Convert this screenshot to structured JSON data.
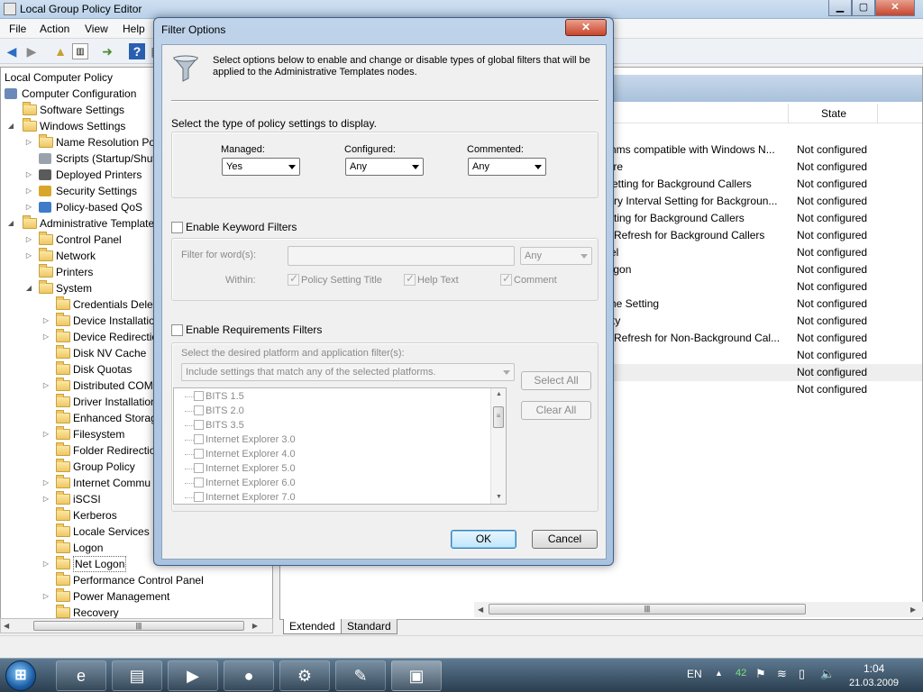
{
  "window": {
    "title": "Local Group Policy Editor",
    "controls": {
      "minimize": "▁",
      "maximize": "▢",
      "close": "✕"
    }
  },
  "menu": [
    "File",
    "Action",
    "View",
    "Help"
  ],
  "toolbar_icons": [
    "back-arrow-icon",
    "forward-arrow-icon",
    "up-folder-icon",
    "show-hide-tree-icon",
    "export-list-icon",
    "help-icon",
    "properties-icon"
  ],
  "tree": {
    "items": [
      {
        "label": "Local Computer Policy",
        "level": 0,
        "icon": "none",
        "expander": ""
      },
      {
        "label": "Computer Configuration",
        "level": 0,
        "icon": "computer",
        "expander": ""
      },
      {
        "label": "Software Settings",
        "level": 1,
        "icon": "folder",
        "expander": ""
      },
      {
        "label": "Windows Settings",
        "level": 1,
        "icon": "folder",
        "expander": "◢"
      },
      {
        "label": "Name Resolution Po",
        "level": 2,
        "icon": "folder",
        "expander": "▷"
      },
      {
        "label": "Scripts (Startup/Shut",
        "level": 2,
        "icon": "scripts",
        "expander": ""
      },
      {
        "label": "Deployed Printers",
        "level": 2,
        "icon": "printer",
        "expander": "▷"
      },
      {
        "label": "Security Settings",
        "level": 2,
        "icon": "security",
        "expander": "▷"
      },
      {
        "label": "Policy-based QoS",
        "level": 2,
        "icon": "chart",
        "expander": "▷"
      },
      {
        "label": "Administrative Templates",
        "level": 1,
        "icon": "folder",
        "expander": "◢"
      },
      {
        "label": "Control Panel",
        "level": 2,
        "icon": "folder",
        "expander": "▷"
      },
      {
        "label": "Network",
        "level": 2,
        "icon": "folder",
        "expander": "▷"
      },
      {
        "label": "Printers",
        "level": 2,
        "icon": "folder",
        "expander": ""
      },
      {
        "label": "System",
        "level": 2,
        "icon": "folder",
        "expander": "◢"
      },
      {
        "label": "Credentials Deleg",
        "level": 3,
        "icon": "folder",
        "expander": ""
      },
      {
        "label": "Device Installatio",
        "level": 3,
        "icon": "folder",
        "expander": "▷"
      },
      {
        "label": "Device Redirectio",
        "level": 3,
        "icon": "folder",
        "expander": "▷"
      },
      {
        "label": "Disk NV Cache",
        "level": 3,
        "icon": "folder",
        "expander": ""
      },
      {
        "label": "Disk Quotas",
        "level": 3,
        "icon": "folder",
        "expander": ""
      },
      {
        "label": "Distributed COM",
        "level": 3,
        "icon": "folder",
        "expander": "▷"
      },
      {
        "label": "Driver Installation",
        "level": 3,
        "icon": "folder",
        "expander": ""
      },
      {
        "label": "Enhanced Storag",
        "level": 3,
        "icon": "folder",
        "expander": ""
      },
      {
        "label": "Filesystem",
        "level": 3,
        "icon": "folder",
        "expander": "▷"
      },
      {
        "label": "Folder Redirectio",
        "level": 3,
        "icon": "folder",
        "expander": ""
      },
      {
        "label": "Group Policy",
        "level": 3,
        "icon": "folder",
        "expander": ""
      },
      {
        "label": "Internet Commu",
        "level": 3,
        "icon": "folder",
        "expander": "▷"
      },
      {
        "label": "iSCSI",
        "level": 3,
        "icon": "folder",
        "expander": "▷"
      },
      {
        "label": "Kerberos",
        "level": 3,
        "icon": "folder",
        "expander": ""
      },
      {
        "label": "Locale Services",
        "level": 3,
        "icon": "folder",
        "expander": ""
      },
      {
        "label": "Logon",
        "level": 3,
        "icon": "folder",
        "expander": ""
      },
      {
        "label": "Net Logon",
        "level": 3,
        "icon": "folder",
        "expander": "▷",
        "selected": true
      },
      {
        "label": "Performance Control Panel",
        "level": 3,
        "icon": "folder",
        "expander": ""
      },
      {
        "label": "Power Management",
        "level": 3,
        "icon": "folder",
        "expander": "▷"
      },
      {
        "label": "Recovery",
        "level": 3,
        "icon": "folder",
        "expander": ""
      }
    ]
  },
  "right_panel": {
    "state_header": "State",
    "rows": [
      {
        "setting": "ithms compatible with Windows N...",
        "state": "Not configured"
      },
      {
        "setting": "lure",
        "state": "Not configured"
      },
      {
        "setting": "Setting for Background Callers",
        "state": "Not configured"
      },
      {
        "setting": "etry Interval Setting for Backgroun...",
        "state": "Not configured"
      },
      {
        "setting": "etting for Background Callers",
        "state": "Not configured"
      },
      {
        "setting": "e Refresh for Background Callers",
        "state": "Not configured"
      },
      {
        "setting": "vel",
        "state": "Not configured"
      },
      {
        "setting": "logon",
        "state": "Not configured"
      },
      {
        "setting": "",
        "state": "Not configured"
      },
      {
        "setting": "che Setting",
        "state": "Not configured"
      },
      {
        "setting": "ility",
        "state": "Not configured"
      },
      {
        "setting": "e Refresh for Non-Background Cal...",
        "state": "Not configured"
      },
      {
        "setting": "",
        "state": "Not configured"
      },
      {
        "setting": "",
        "state": "Not configured",
        "selected": true
      },
      {
        "setting": "",
        "state": "Not configured"
      }
    ],
    "tabs": [
      "Extended",
      "Standard"
    ]
  },
  "dialog": {
    "title": "Filter Options",
    "close": "✕",
    "intro": "Select options below to enable and change or disable types of global filters that will be applied to the Administrative Templates nodes.",
    "type_prompt": "Select the type of policy settings to display.",
    "managed_label": "Managed:",
    "managed_value": "Yes",
    "configured_label": "Configured:",
    "configured_value": "Any",
    "commented_label": "Commented:",
    "commented_value": "Any",
    "keyword_checkbox": "Enable Keyword Filters",
    "filter_words_label": "Filter for word(s):",
    "filter_words_value": "",
    "filter_words_mode": "Any",
    "within_label": "Within:",
    "within_options": [
      "Policy Setting Title",
      "Help Text",
      "Comment"
    ],
    "requirements_checkbox": "Enable Requirements Filters",
    "platform_prompt": "Select the desired platform and application filter(s):",
    "platform_mode": "Include settings that match any of the selected platforms.",
    "platform_items": [
      "BITS 1.5",
      "BITS 2.0",
      "BITS 3.5",
      "Internet Explorer 3.0",
      "Internet Explorer 4.0",
      "Internet Explorer 5.0",
      "Internet Explorer 6.0",
      "Internet Explorer 7.0"
    ],
    "select_all": "Select All",
    "clear_all": "Clear All",
    "ok": "OK",
    "cancel": "Cancel"
  },
  "taskbar": {
    "start_glyph": "⊞",
    "apps": [
      {
        "icon": "internet-explorer-icon",
        "glyph": "e"
      },
      {
        "icon": "file-explorer-icon",
        "glyph": "▤"
      },
      {
        "icon": "media-player-icon",
        "glyph": "▶"
      },
      {
        "icon": "firefox-icon",
        "glyph": "●"
      },
      {
        "icon": "network-tool-icon",
        "glyph": "⚙"
      },
      {
        "icon": "paint-icon",
        "glyph": "✎"
      },
      {
        "icon": "toolbox-icon",
        "glyph": "▣",
        "active": true
      }
    ],
    "language": "EN",
    "tray_number": "42",
    "time": "1:04",
    "date": "21.03.2009"
  }
}
